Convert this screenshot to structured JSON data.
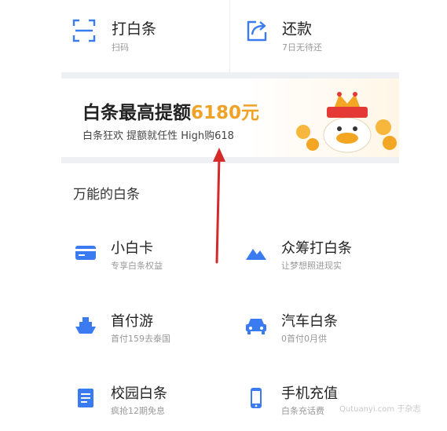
{
  "top_actions": [
    {
      "title": "打白条",
      "sub": "扫码",
      "icon": "scan-icon"
    },
    {
      "title": "还款",
      "sub": "7日无待还",
      "icon": "share-repay-icon"
    }
  ],
  "banner": {
    "title_prefix": "白条最高提额",
    "title_amount": "6180元",
    "subtitle": "白条狂欢 提额就任性 High购618"
  },
  "section": {
    "title": "万能的白条"
  },
  "grid": [
    {
      "title": "小白卡",
      "sub": "专享白条权益",
      "icon": "card-icon"
    },
    {
      "title": "众筹打白条",
      "sub": "让梦想照进现实",
      "icon": "mountain-icon"
    },
    {
      "title": "首付游",
      "sub": "首付159去泰国",
      "icon": "ship-icon"
    },
    {
      "title": "汽车白条",
      "sub": "0首付0月供",
      "icon": "car-icon"
    },
    {
      "title": "校园白条",
      "sub": "疯抢12期免息",
      "icon": "document-icon"
    },
    {
      "title": "手机充值",
      "sub": "白条充话费",
      "icon": "phone-icon"
    }
  ],
  "colors": {
    "accent": "#3a7bf2",
    "amount": "#f0a227",
    "arrow": "#d42a2a"
  }
}
